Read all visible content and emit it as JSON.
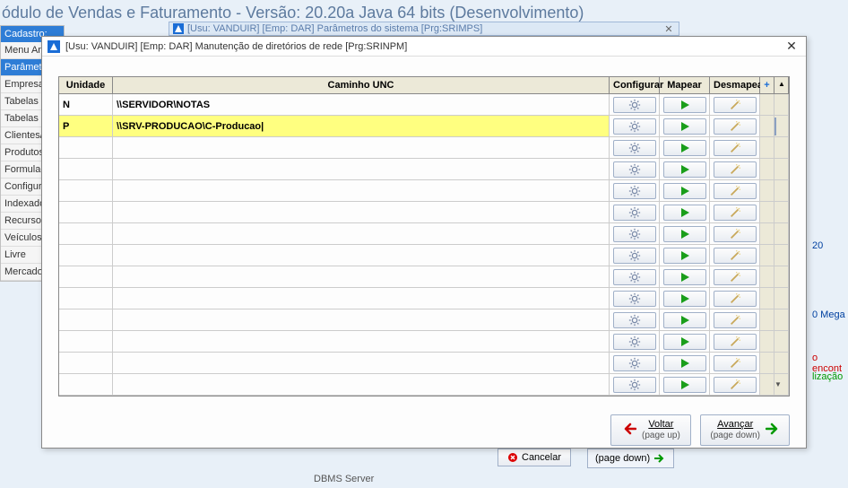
{
  "main_title": "ódulo de Vendas e Faturamento - Versão: 20.20a Java 64 bits (Desenvolvimento)",
  "sidebar": {
    "header": "Cadastro:",
    "items": [
      "Menu An",
      "Parâmetro",
      "Empresas",
      "Tabelas G",
      "Tabelas p",
      "Clientes/F",
      "Produtos",
      "Formulaçã",
      "Configura",
      "Indexado",
      "Recursos",
      "Veículos",
      "Livre",
      "Mercador"
    ],
    "selected_index": 1
  },
  "bg_window": {
    "title": "[Usu: VANDUIR] [Emp: DAR] Parâmetros do sistema [Prg:SRIMPS]"
  },
  "bg_fragments": {
    "f1": "20",
    "f2": "0 Mega",
    "f3": "o encont",
    "f4": "lização"
  },
  "partial_btn": "(page down)",
  "bottom_label": "DBMS Server",
  "dialog": {
    "title": "[Usu: VANDUIR] [Emp: DAR] Manutenção de diretórios de rede [Prg:SRINPM]",
    "columns": {
      "unidade": "Unidade",
      "unc": "Caminho UNC",
      "configurar": "Configurar",
      "mapear": "Mapear",
      "desmapear": "Desmapear"
    },
    "rows": [
      {
        "unidade": "N",
        "unc": "\\\\SERVIDOR\\NOTAS"
      },
      {
        "unidade": "P",
        "unc": "\\\\SRV-PRODUCAO\\C-Producao|"
      },
      {
        "unidade": "",
        "unc": ""
      },
      {
        "unidade": "",
        "unc": ""
      },
      {
        "unidade": "",
        "unc": ""
      },
      {
        "unidade": "",
        "unc": ""
      },
      {
        "unidade": "",
        "unc": ""
      },
      {
        "unidade": "",
        "unc": ""
      },
      {
        "unidade": "",
        "unc": ""
      },
      {
        "unidade": "",
        "unc": ""
      },
      {
        "unidade": "",
        "unc": ""
      },
      {
        "unidade": "",
        "unc": ""
      },
      {
        "unidade": "",
        "unc": ""
      },
      {
        "unidade": "",
        "unc": ""
      }
    ],
    "selected_row": 1,
    "footer": {
      "back_label": "Voltar",
      "back_sub": "(page up)",
      "next_label": "Avançar",
      "next_sub": "(page down)"
    }
  },
  "cancel_partial": "Cancelar"
}
